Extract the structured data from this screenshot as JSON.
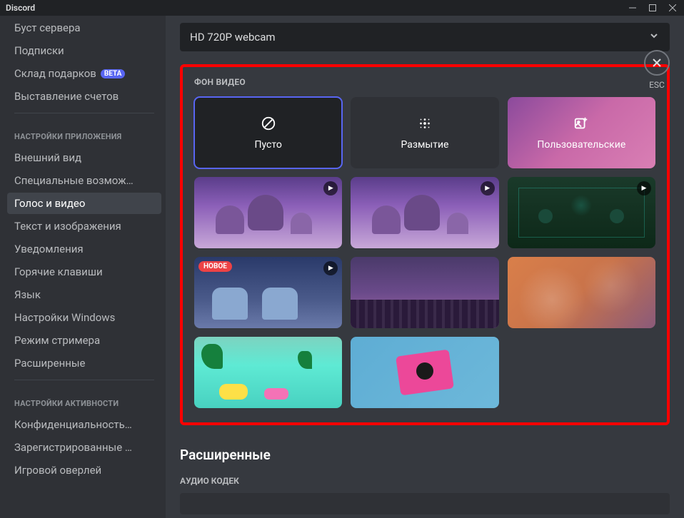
{
  "app": {
    "title": "Discord"
  },
  "sidebar": {
    "items_top": [
      {
        "label": "Буст сервера"
      },
      {
        "label": "Подписки"
      },
      {
        "label": "Склад подарков",
        "badge": "BETA"
      },
      {
        "label": "Выставление счетов"
      }
    ],
    "header_app": "НАСТРОЙКИ ПРИЛОЖЕНИЯ",
    "items_app": [
      {
        "label": "Внешний вид"
      },
      {
        "label": "Специальные возмож…"
      },
      {
        "label": "Голос и видео",
        "active": true
      },
      {
        "label": "Текст и изображения"
      },
      {
        "label": "Уведомления"
      },
      {
        "label": "Горячие клавиши"
      },
      {
        "label": "Язык"
      },
      {
        "label": "Настройки Windows"
      },
      {
        "label": "Режим стримера"
      },
      {
        "label": "Расширенные"
      }
    ],
    "header_activity": "НАСТРОЙКИ АКТИВНОСТИ",
    "items_activity": [
      {
        "label": "Конфиденциальность…"
      },
      {
        "label": "Зарегистрированные …"
      },
      {
        "label": "Игровой оверлей"
      }
    ]
  },
  "camera": {
    "selected": "HD 720P webcam"
  },
  "video_bg": {
    "title": "ФОН ВИДЕО",
    "empty": "Пусто",
    "blur": "Размытие",
    "custom": "Пользовательские",
    "new_badge": "НОВОЕ"
  },
  "advanced": {
    "title": "Расширенные",
    "codec_label": "АУДИО КОДЕК"
  },
  "close": {
    "esc": "ESC"
  }
}
